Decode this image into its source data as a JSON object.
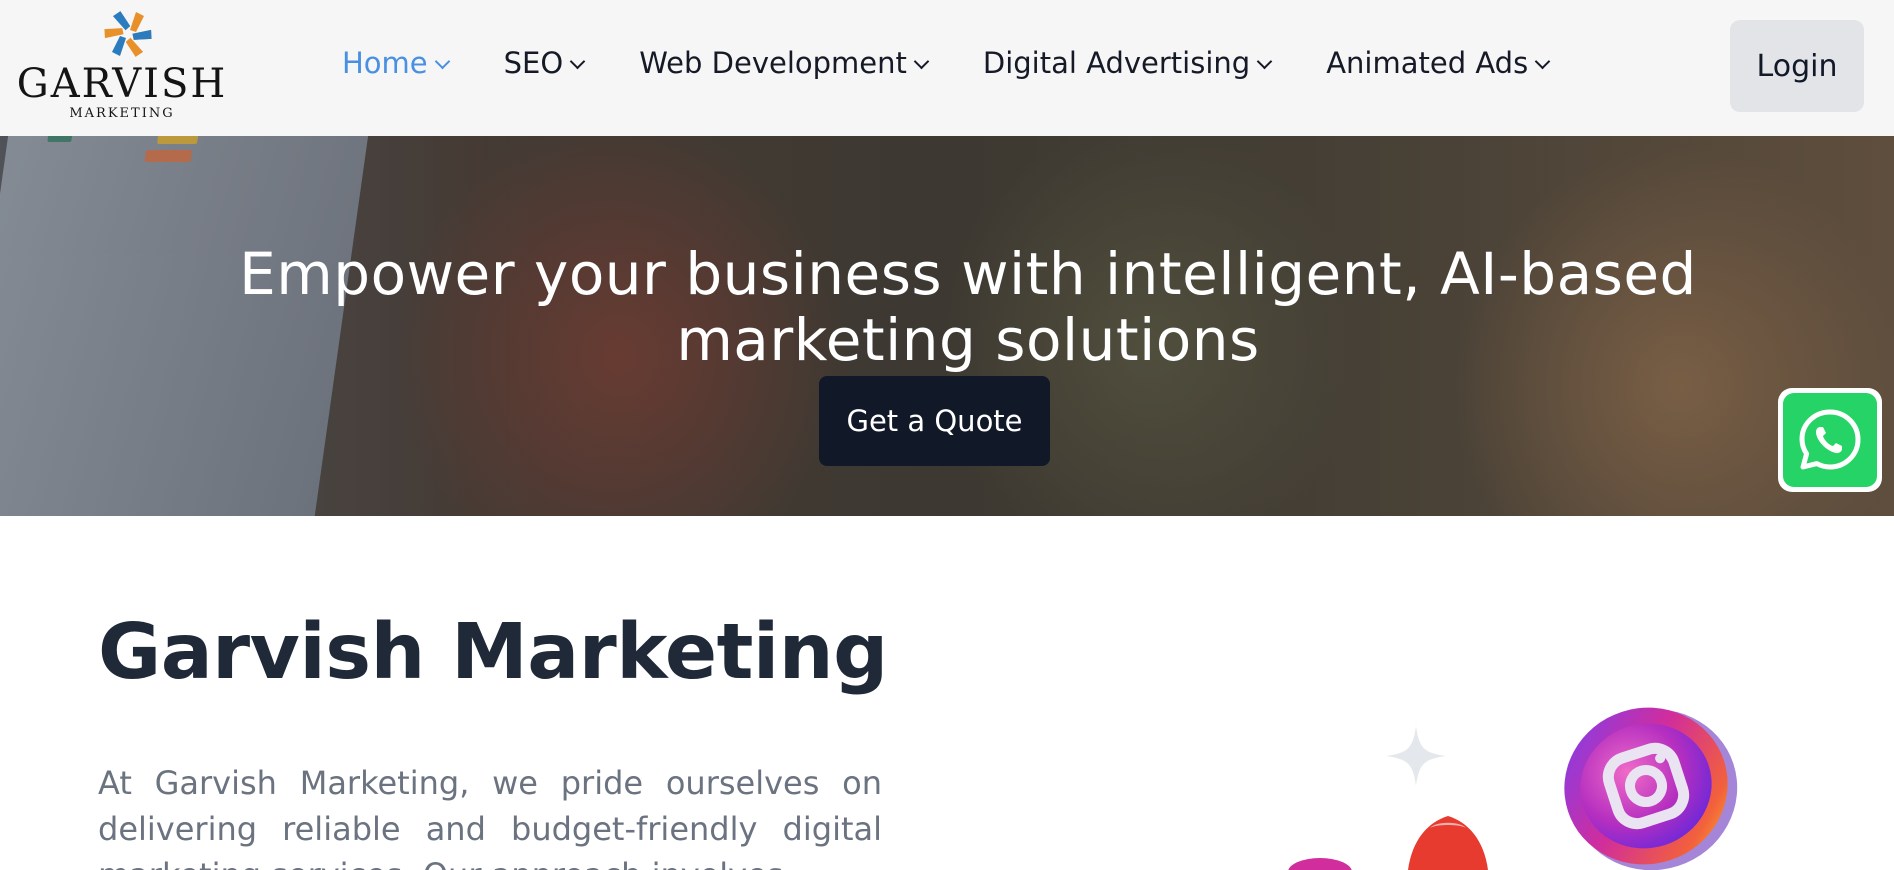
{
  "header": {
    "logo": {
      "name": "GARVISH",
      "sub": "MARKETING"
    },
    "nav": [
      {
        "label": "Home",
        "active": true
      },
      {
        "label": "SEO",
        "active": false
      },
      {
        "label": "Web Development",
        "active": false
      },
      {
        "label": "Digital Advertising",
        "active": false
      },
      {
        "label": "Animated Ads",
        "active": false
      }
    ],
    "login_label": "Login"
  },
  "hero": {
    "title": "Empower your business with intelligent, AI-based marketing solutions",
    "cta_label": "Get a Quote"
  },
  "about": {
    "title": "Garvish Marketing",
    "text": "At Garvish Marketing, we pride ourselves on delivering reliable and budget-friendly digital marketing services. Our approach involves"
  },
  "floating": {
    "whatsapp_icon": "whatsapp-icon"
  },
  "colors": {
    "nav_active": "#4a90e2",
    "cta_bg": "#111827",
    "heading": "#1f2937",
    "body_text": "#6b7280",
    "whatsapp": "#25d366",
    "logo_orange": "#e8902a",
    "logo_blue": "#2b7bbf"
  },
  "icons": [
    "logo-pinwheel-icon",
    "chevron-down-icon",
    "whatsapp-icon",
    "instagram-icon",
    "sparkle-icon",
    "rocket-icon"
  ]
}
